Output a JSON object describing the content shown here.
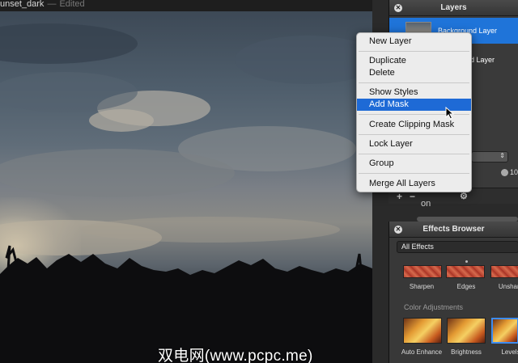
{
  "window": {
    "document_name": "unset_dark",
    "separator": "—",
    "status": "Edited"
  },
  "layers_panel": {
    "title": "Layers",
    "close_icon": "close-icon",
    "layers": [
      {
        "name": "Background Layer",
        "selected": true
      },
      {
        "name": "d Layer",
        "selected": false
      }
    ],
    "opacity_value": "10",
    "footer": {
      "add": "+",
      "remove": "−",
      "gear": "⚙"
    },
    "behind_text": "on"
  },
  "context_menu": {
    "items": [
      {
        "label": "New Layer",
        "highlighted": false
      },
      {
        "label": "Duplicate",
        "highlighted": false
      },
      {
        "label": "Delete",
        "highlighted": false
      },
      {
        "label": "Show Styles",
        "highlighted": false
      },
      {
        "label": "Add Mask",
        "highlighted": true
      },
      {
        "label": "Create Clipping Mask",
        "highlighted": false
      },
      {
        "label": "Lock Layer",
        "highlighted": false
      },
      {
        "label": "Group",
        "highlighted": false
      },
      {
        "label": "Merge All Layers",
        "highlighted": false
      }
    ]
  },
  "effects_browser": {
    "title": "Effects Browser",
    "filter_value": "All Effects",
    "top_row": [
      "Sharpen",
      "Edges",
      "Unsharp"
    ],
    "section_label": "Color Adjustments",
    "bottom_row": [
      "Auto Enhance",
      "Brightness",
      "Levels"
    ]
  },
  "watermark": "双电网(www.pcpc.me)",
  "colors": {
    "selection_blue": "#1f74d9",
    "menu_highlight": "#1e6ad6"
  }
}
